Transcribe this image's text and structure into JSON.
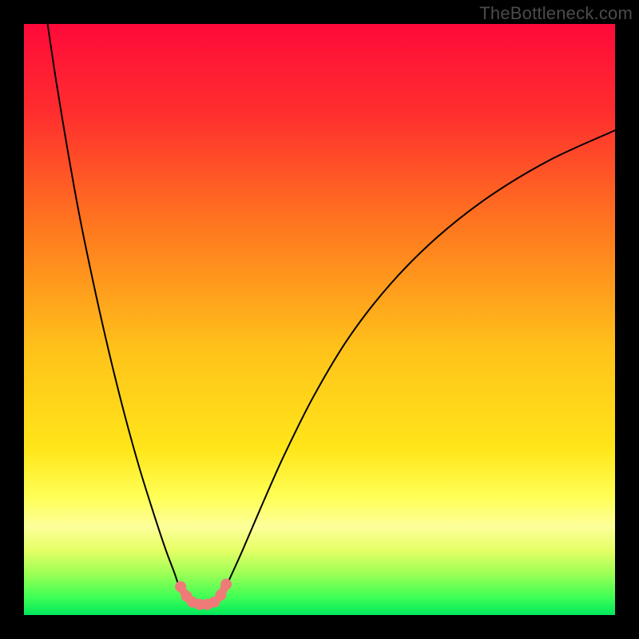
{
  "watermark": "TheBottleneck.com",
  "chart_data": {
    "type": "line",
    "title": "",
    "xlabel": "",
    "ylabel": "",
    "xlim": [
      0,
      100
    ],
    "ylim": [
      0,
      100
    ],
    "grid": false,
    "legend": false,
    "background_gradient": {
      "stops": [
        {
          "offset": 0.0,
          "color": "#ff0a3a"
        },
        {
          "offset": 0.15,
          "color": "#ff2e2e"
        },
        {
          "offset": 0.35,
          "color": "#ff7a1f"
        },
        {
          "offset": 0.55,
          "color": "#ffc21a"
        },
        {
          "offset": 0.72,
          "color": "#ffe61a"
        },
        {
          "offset": 0.8,
          "color": "#ffff55"
        },
        {
          "offset": 0.85,
          "color": "#fdff9a"
        },
        {
          "offset": 0.89,
          "color": "#e6ff66"
        },
        {
          "offset": 0.93,
          "color": "#9cff55"
        },
        {
          "offset": 0.97,
          "color": "#3fff55"
        },
        {
          "offset": 1.0,
          "color": "#00e85c"
        }
      ]
    },
    "series": [
      {
        "name": "bottleneck-curve-left",
        "stroke": "#000000",
        "stroke_width": 2,
        "x": [
          4.0,
          5.5,
          7.5,
          9.5,
          12.0,
          14.5,
          17.0,
          19.5,
          22.0,
          24.0,
          25.5,
          26.5,
          27.2
        ],
        "y": [
          100.0,
          90.0,
          78.0,
          67.0,
          55.0,
          44.0,
          34.0,
          25.0,
          17.0,
          11.0,
          7.0,
          4.0,
          2.5
        ]
      },
      {
        "name": "bottleneck-curve-right",
        "stroke": "#000000",
        "stroke_width": 2,
        "x": [
          33.0,
          34.5,
          37.0,
          40.0,
          44.0,
          49.0,
          55.0,
          62.0,
          70.0,
          79.0,
          89.0,
          100.0
        ],
        "y": [
          2.5,
          5.5,
          11.0,
          18.0,
          27.0,
          37.0,
          47.0,
          56.0,
          64.0,
          71.0,
          77.0,
          82.0
        ]
      },
      {
        "name": "sweet-spot-markers",
        "type": "scatter",
        "color": "#ef7b78",
        "marker_radius": 7,
        "x": [
          26.5,
          27.5,
          28.5,
          29.7,
          31.0,
          32.2,
          33.3,
          34.2
        ],
        "y": [
          4.8,
          3.2,
          2.2,
          1.8,
          1.8,
          2.2,
          3.4,
          5.2
        ]
      },
      {
        "name": "sweet-spot-arc",
        "stroke": "#ef7b78",
        "stroke_width": 10,
        "x": [
          26.5,
          27.5,
          28.5,
          29.7,
          31.0,
          32.2,
          33.3,
          34.2
        ],
        "y": [
          4.8,
          3.2,
          2.2,
          1.8,
          1.8,
          2.2,
          3.4,
          5.2
        ]
      }
    ]
  }
}
